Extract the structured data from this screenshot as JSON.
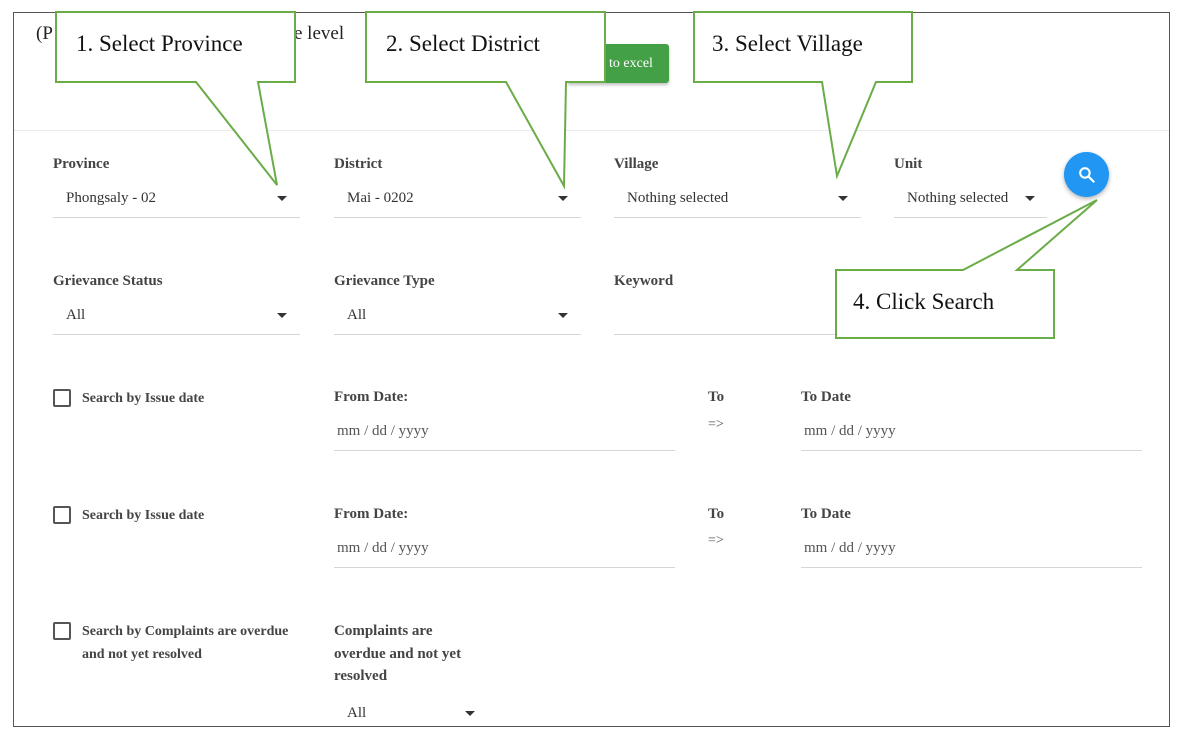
{
  "header": {
    "partial_left": "(P",
    "partial_right": "e level",
    "export_button_label": "to excel"
  },
  "filters": {
    "province": {
      "label": "Province",
      "value": "Phongsaly - 02"
    },
    "district": {
      "label": "District",
      "value": "Mai - 0202"
    },
    "village": {
      "label": "Village",
      "value": "Nothing selected"
    },
    "unit": {
      "label": "Unit",
      "value": "Nothing selected"
    },
    "grievance_status": {
      "label": "Grievance Status",
      "value": "All"
    },
    "grievance_type": {
      "label": "Grievance Type",
      "value": "All"
    },
    "keyword": {
      "label": "Keyword",
      "value": ""
    }
  },
  "date_rows": [
    {
      "checkbox_label": "Search by Issue date",
      "from_label": "From Date:",
      "from_placeholder": "mm / dd / yyyy",
      "to_label": "To",
      "arrow": "=>",
      "to_date_label": "To Date",
      "to_placeholder": "mm / dd / yyyy"
    },
    {
      "checkbox_label": "Search by Issue date",
      "from_label": "From Date:",
      "from_placeholder": "mm / dd / yyyy",
      "to_label": "To",
      "arrow": "=>",
      "to_date_label": "To Date",
      "to_placeholder": "mm / dd / yyyy"
    }
  ],
  "overdue": {
    "checkbox_label_line1": "Search by Complaints are overdue",
    "checkbox_label_line2": "and not yet resolved",
    "select_label_line1": "Complaints are",
    "select_label_line2": "overdue and not yet",
    "select_label_line3": "resolved",
    "select_value": "All"
  },
  "callouts": {
    "step1": "1. Select Province",
    "step2": "2. Select District",
    "step3": "3. Select Village",
    "step4": "4. Click Search"
  },
  "icons": {
    "search": "search-icon",
    "caret": "caret-down-icon"
  },
  "colors": {
    "accent": "#2196f3",
    "export_green": "#43a047",
    "callout_border": "#6aac47"
  }
}
